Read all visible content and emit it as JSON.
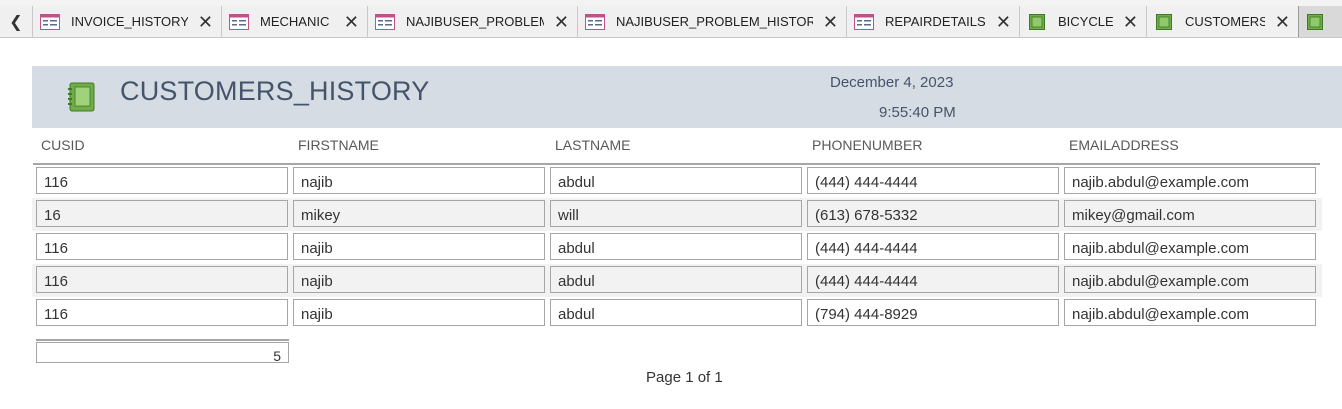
{
  "tabs": [
    {
      "label": "INVOICE_HISTORY",
      "icon": "report-icon"
    },
    {
      "label": "MECHANIC",
      "icon": "report-icon"
    },
    {
      "label": "NAJIBUSER_PROBLEM",
      "icon": "report-icon"
    },
    {
      "label": "NAJIBUSER_PROBLEM_HISTORY",
      "icon": "report-icon"
    },
    {
      "label": "REPAIRDETAILS",
      "icon": "report-icon"
    },
    {
      "label": "BICYCLE",
      "icon": "form-icon"
    },
    {
      "label": "CUSTOMERS",
      "icon": "form-icon"
    }
  ],
  "report": {
    "title": "CUSTOMERS_HISTORY",
    "date": "December 4, 2023",
    "time": "9:55:40 PM",
    "columns": [
      "CUSID",
      "FIRSTNAME",
      "LASTNAME",
      "PHONENUMBER",
      "EMAILADDRESS"
    ],
    "rows": [
      [
        "116",
        "najib",
        "abdul",
        "(444) 444-4444",
        "najib.abdul@example.com"
      ],
      [
        "16",
        "mikey",
        "will",
        "(613) 678-5332",
        "mikey@gmail.com"
      ],
      [
        "116",
        "najib",
        "abdul",
        "(444) 444-4444",
        "najib.abdul@example.com"
      ],
      [
        "116",
        "najib",
        "abdul",
        "(444) 444-4444",
        "najib.abdul@example.com"
      ],
      [
        "116",
        "najib",
        "abdul",
        "(794) 444-8929",
        "najib.abdul@example.com"
      ]
    ],
    "record_count": "5",
    "page_footer": "Page 1 of 1"
  },
  "colors": {
    "header_band": "#d6dce4",
    "title_text": "#44546a",
    "form_icon": "#70ad47",
    "report_icon": "#c00060"
  }
}
